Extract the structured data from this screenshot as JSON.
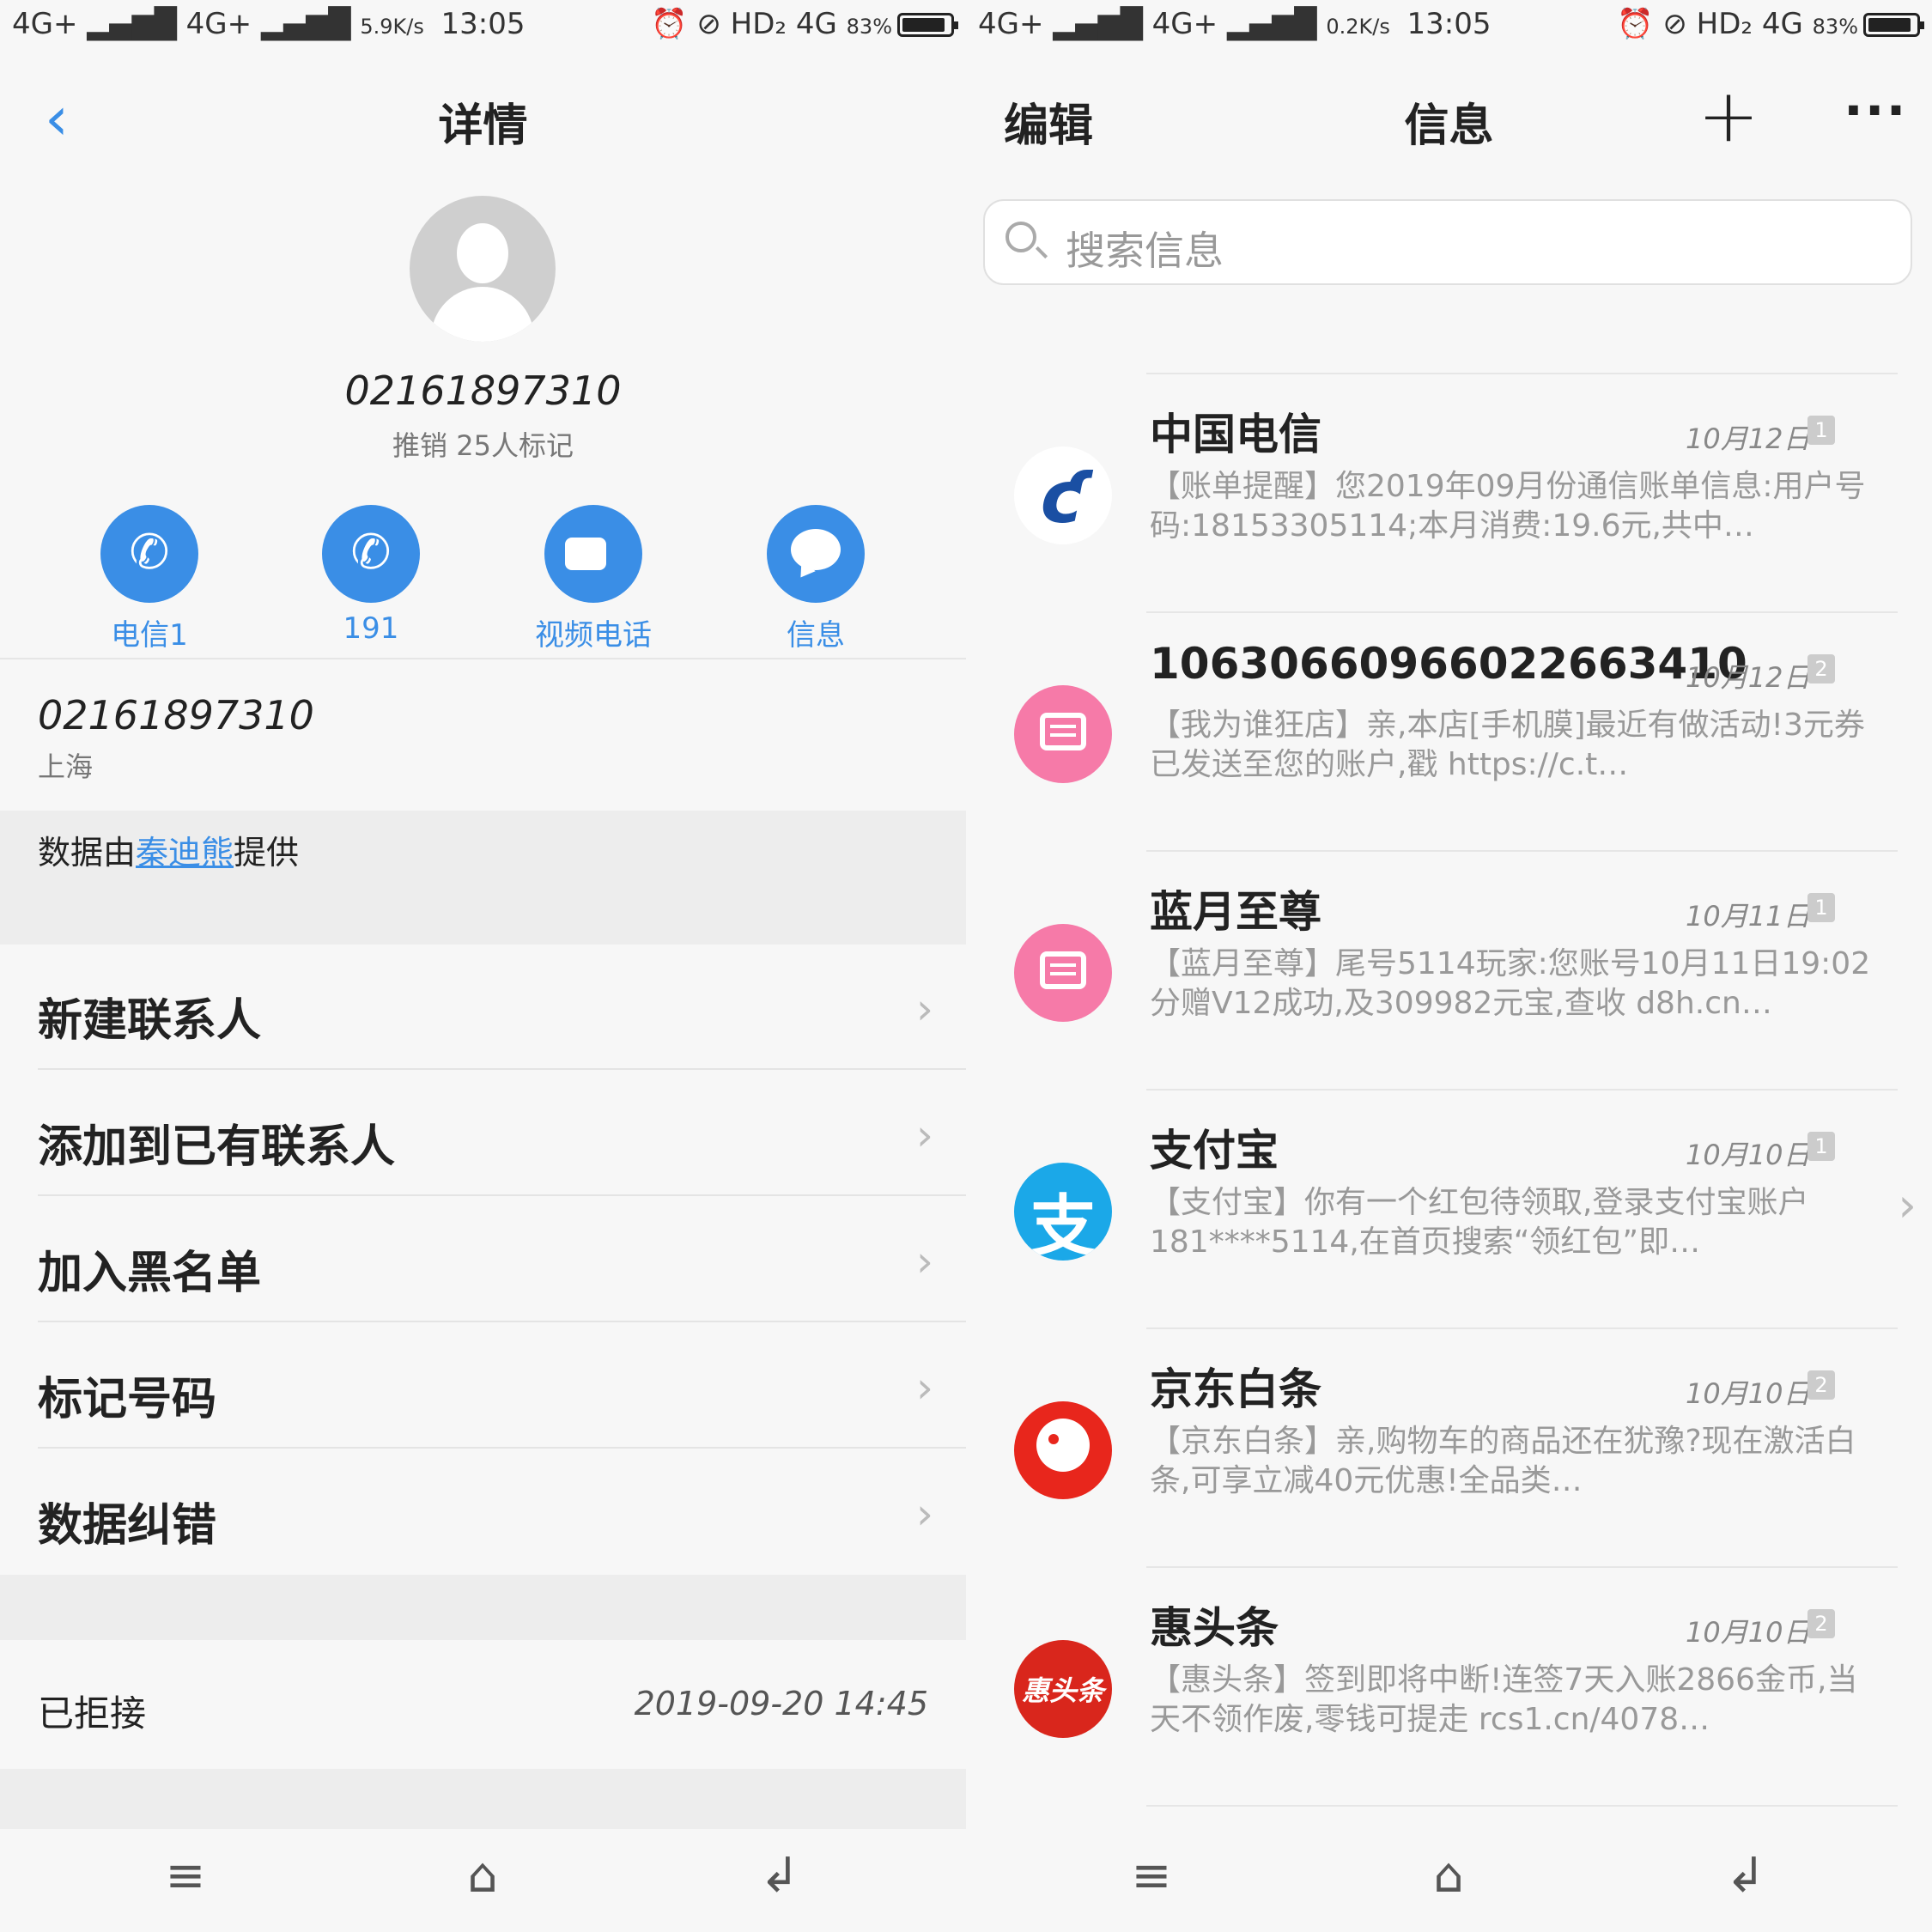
{
  "left": {
    "status": {
      "signal": "4G+ ▂▄▆█  4G+ ▂▄▆█",
      "speed": "5.9K/s",
      "time": "13:05",
      "icons": "⏰ ⊘ HD₂ 4G",
      "battery": "83%"
    },
    "header_title": "详情",
    "back_glyph": "‹",
    "number": "02161897310",
    "mark_text": "推销 25人标记",
    "actions": [
      {
        "label": "电信1"
      },
      {
        "label": "191"
      },
      {
        "label": "视频电话"
      },
      {
        "label": "信息"
      }
    ],
    "info": {
      "number": "02161897310",
      "city": "上海"
    },
    "provider": {
      "prefix": "数据由",
      "link": "秦迪熊",
      "suffix": "提供"
    },
    "menu": [
      "新建联系人",
      "添加到已有联系人",
      "加入黑名单",
      "标记号码",
      "数据纠错"
    ],
    "rejected": {
      "label": "已拒接",
      "time": "2019-09-20 14:45"
    }
  },
  "right": {
    "status": {
      "signal": "4G+ ▂▄▆█  4G+ ▂▄▆█",
      "speed": "0.2K/s",
      "time": "13:05",
      "icons": "⏰ ⊘ HD₂ 4G",
      "battery": "83%"
    },
    "edit_label": "编辑",
    "title": "信息",
    "plus_glyph": "+",
    "more_glyph": "···",
    "search_placeholder": "搜索信息",
    "threads": [
      {
        "name": "中国电信",
        "date": "10月12日",
        "count": "1",
        "preview": "【账单提醒】您2019年09月份通信账单信息:用户号码:18153305114;本月消费:19.6元,共中…",
        "icon": "china-telecom-logo",
        "avatar_glyph": "ƈ"
      },
      {
        "name": "106306609660226634​10",
        "date": "10月12日",
        "count": "2",
        "preview": "【我为谁狂店】亲,本店[手机膜]最近有做活动!3元券已发送至您的账户,戳 https://c.t…",
        "icon": "message-icon",
        "avatar_glyph": ""
      },
      {
        "name": "蓝月至尊",
        "date": "10月11日",
        "count": "1",
        "preview": "【蓝月至尊】尾号5114玩家:您账号10月11日19:02分赠V12成功,及309982元宝,查收 d8h.cn…",
        "icon": "message-icon",
        "avatar_glyph": ""
      },
      {
        "name": "支付宝",
        "date": "10月10日",
        "count": "1",
        "preview": "【支付宝】你有一个红包待领取,登录支付宝账户181****5114,在首页搜索“领红包”即…",
        "icon": "alipay-logo",
        "avatar_glyph": "支"
      },
      {
        "name": "京东白条",
        "date": "10月10日",
        "count": "2",
        "preview": "【京东白条】亲,购物车的商品还在犹豫?现在激活白条,可享立减40元优惠!全品类…",
        "icon": "jd-logo",
        "avatar_glyph": ""
      },
      {
        "name": "惠头条",
        "date": "10月10日",
        "count": "2",
        "preview": "【惠头条】签到即将中断!连签7天入账2866金币,当天不领作废,零钱可提走 rcs1.cn/4078…",
        "icon": "huitoutiao-logo",
        "avatar_glyph": "惠头条"
      }
    ]
  },
  "navbar": {
    "menu_glyph": "≡",
    "home_glyph": "⌂",
    "back_glyph": "↲"
  },
  "colors": {
    "accent": "#3a8ee6",
    "msg_pink": "#f67aa8",
    "alipay": "#1ba8e8",
    "jd": "#e8261c",
    "hui": "#d9261c"
  }
}
